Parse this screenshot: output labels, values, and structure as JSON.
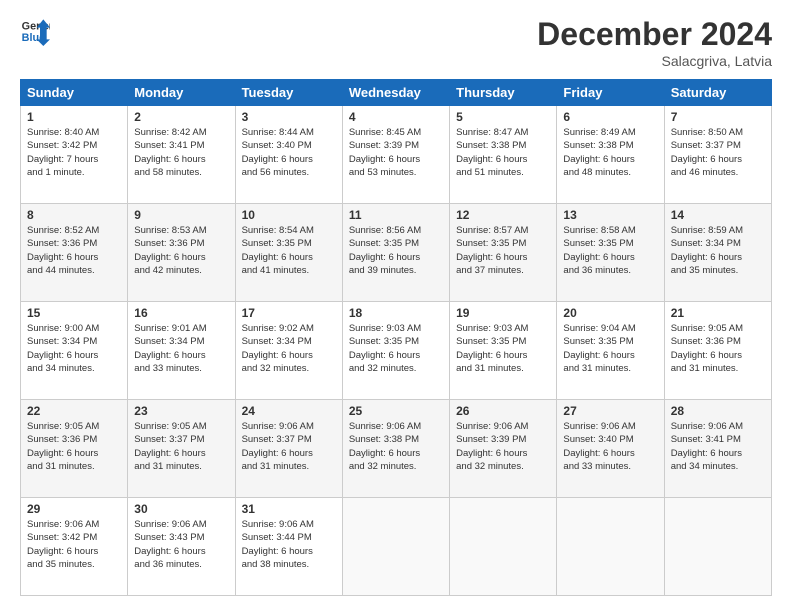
{
  "header": {
    "logo_line1": "General",
    "logo_line2": "Blue",
    "month_title": "December 2024",
    "location": "Salacgriva, Latvia"
  },
  "weekdays": [
    "Sunday",
    "Monday",
    "Tuesday",
    "Wednesday",
    "Thursday",
    "Friday",
    "Saturday"
  ],
  "weeks": [
    [
      {
        "day": 1,
        "info": "Sunrise: 8:40 AM\nSunset: 3:42 PM\nDaylight: 7 hours\nand 1 minute."
      },
      {
        "day": 2,
        "info": "Sunrise: 8:42 AM\nSunset: 3:41 PM\nDaylight: 6 hours\nand 58 minutes."
      },
      {
        "day": 3,
        "info": "Sunrise: 8:44 AM\nSunset: 3:40 PM\nDaylight: 6 hours\nand 56 minutes."
      },
      {
        "day": 4,
        "info": "Sunrise: 8:45 AM\nSunset: 3:39 PM\nDaylight: 6 hours\nand 53 minutes."
      },
      {
        "day": 5,
        "info": "Sunrise: 8:47 AM\nSunset: 3:38 PM\nDaylight: 6 hours\nand 51 minutes."
      },
      {
        "day": 6,
        "info": "Sunrise: 8:49 AM\nSunset: 3:38 PM\nDaylight: 6 hours\nand 48 minutes."
      },
      {
        "day": 7,
        "info": "Sunrise: 8:50 AM\nSunset: 3:37 PM\nDaylight: 6 hours\nand 46 minutes."
      }
    ],
    [
      {
        "day": 8,
        "info": "Sunrise: 8:52 AM\nSunset: 3:36 PM\nDaylight: 6 hours\nand 44 minutes."
      },
      {
        "day": 9,
        "info": "Sunrise: 8:53 AM\nSunset: 3:36 PM\nDaylight: 6 hours\nand 42 minutes."
      },
      {
        "day": 10,
        "info": "Sunrise: 8:54 AM\nSunset: 3:35 PM\nDaylight: 6 hours\nand 41 minutes."
      },
      {
        "day": 11,
        "info": "Sunrise: 8:56 AM\nSunset: 3:35 PM\nDaylight: 6 hours\nand 39 minutes."
      },
      {
        "day": 12,
        "info": "Sunrise: 8:57 AM\nSunset: 3:35 PM\nDaylight: 6 hours\nand 37 minutes."
      },
      {
        "day": 13,
        "info": "Sunrise: 8:58 AM\nSunset: 3:35 PM\nDaylight: 6 hours\nand 36 minutes."
      },
      {
        "day": 14,
        "info": "Sunrise: 8:59 AM\nSunset: 3:34 PM\nDaylight: 6 hours\nand 35 minutes."
      }
    ],
    [
      {
        "day": 15,
        "info": "Sunrise: 9:00 AM\nSunset: 3:34 PM\nDaylight: 6 hours\nand 34 minutes."
      },
      {
        "day": 16,
        "info": "Sunrise: 9:01 AM\nSunset: 3:34 PM\nDaylight: 6 hours\nand 33 minutes."
      },
      {
        "day": 17,
        "info": "Sunrise: 9:02 AM\nSunset: 3:34 PM\nDaylight: 6 hours\nand 32 minutes."
      },
      {
        "day": 18,
        "info": "Sunrise: 9:03 AM\nSunset: 3:35 PM\nDaylight: 6 hours\nand 32 minutes."
      },
      {
        "day": 19,
        "info": "Sunrise: 9:03 AM\nSunset: 3:35 PM\nDaylight: 6 hours\nand 31 minutes."
      },
      {
        "day": 20,
        "info": "Sunrise: 9:04 AM\nSunset: 3:35 PM\nDaylight: 6 hours\nand 31 minutes."
      },
      {
        "day": 21,
        "info": "Sunrise: 9:05 AM\nSunset: 3:36 PM\nDaylight: 6 hours\nand 31 minutes."
      }
    ],
    [
      {
        "day": 22,
        "info": "Sunrise: 9:05 AM\nSunset: 3:36 PM\nDaylight: 6 hours\nand 31 minutes."
      },
      {
        "day": 23,
        "info": "Sunrise: 9:05 AM\nSunset: 3:37 PM\nDaylight: 6 hours\nand 31 minutes."
      },
      {
        "day": 24,
        "info": "Sunrise: 9:06 AM\nSunset: 3:37 PM\nDaylight: 6 hours\nand 31 minutes."
      },
      {
        "day": 25,
        "info": "Sunrise: 9:06 AM\nSunset: 3:38 PM\nDaylight: 6 hours\nand 32 minutes."
      },
      {
        "day": 26,
        "info": "Sunrise: 9:06 AM\nSunset: 3:39 PM\nDaylight: 6 hours\nand 32 minutes."
      },
      {
        "day": 27,
        "info": "Sunrise: 9:06 AM\nSunset: 3:40 PM\nDaylight: 6 hours\nand 33 minutes."
      },
      {
        "day": 28,
        "info": "Sunrise: 9:06 AM\nSunset: 3:41 PM\nDaylight: 6 hours\nand 34 minutes."
      }
    ],
    [
      {
        "day": 29,
        "info": "Sunrise: 9:06 AM\nSunset: 3:42 PM\nDaylight: 6 hours\nand 35 minutes."
      },
      {
        "day": 30,
        "info": "Sunrise: 9:06 AM\nSunset: 3:43 PM\nDaylight: 6 hours\nand 36 minutes."
      },
      {
        "day": 31,
        "info": "Sunrise: 9:06 AM\nSunset: 3:44 PM\nDaylight: 6 hours\nand 38 minutes."
      },
      null,
      null,
      null,
      null
    ]
  ]
}
